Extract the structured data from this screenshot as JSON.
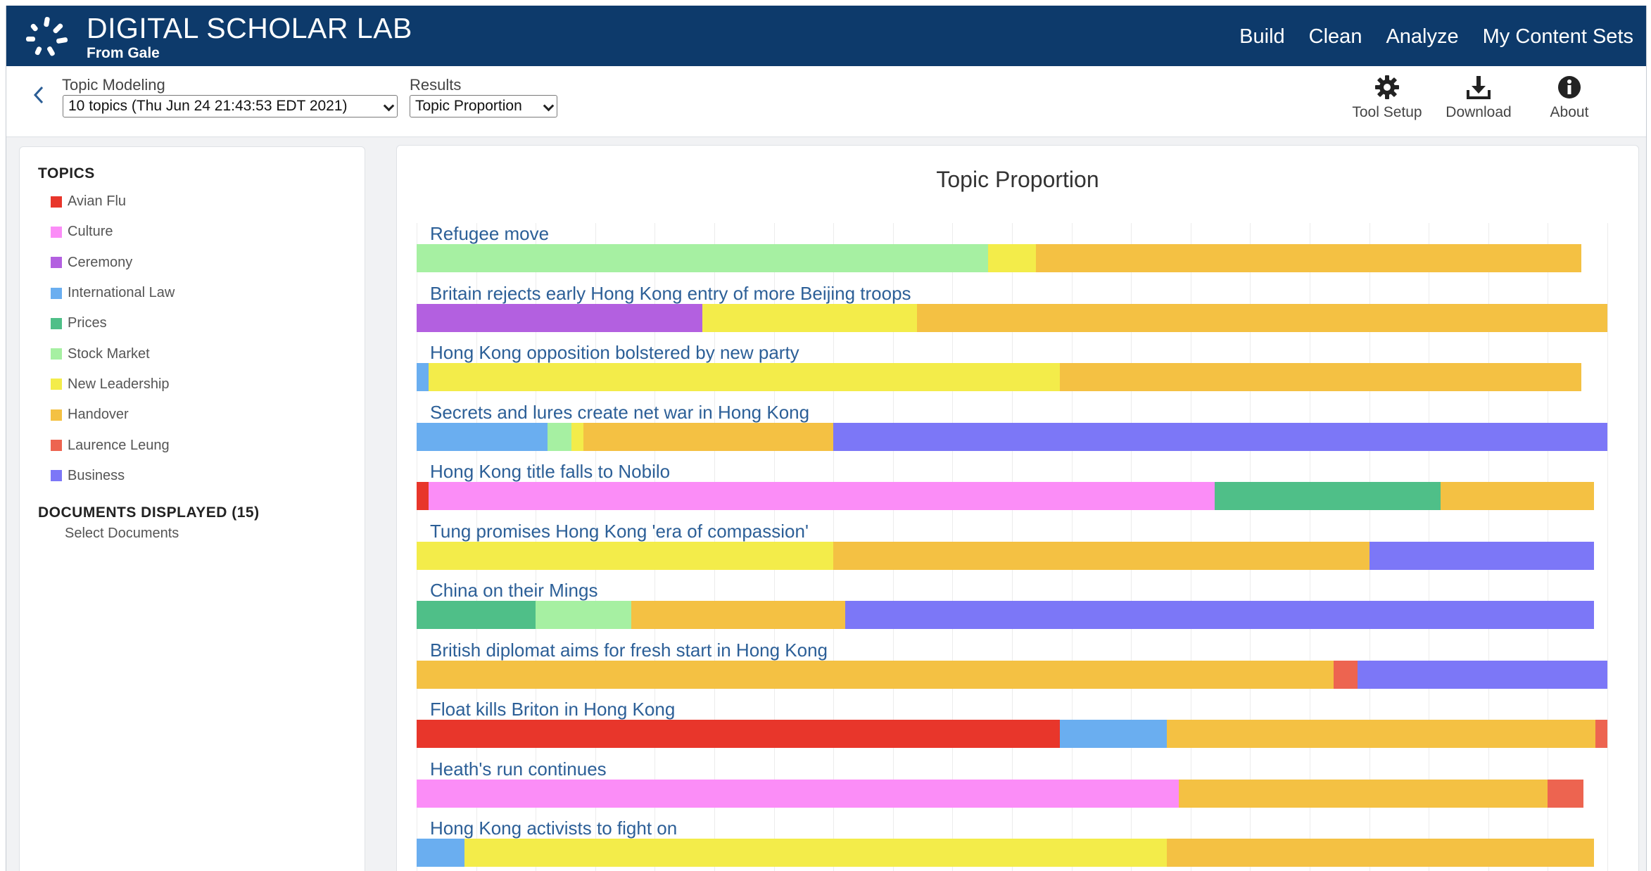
{
  "app": {
    "brand": "DIGITAL SCHOLAR LAB",
    "brand_sub": "From Gale",
    "nav": [
      "Build",
      "Clean",
      "Analyze",
      "My Content Sets"
    ],
    "header_color": "#0d3a6b"
  },
  "toolbar": {
    "back_icon": "chevron-left-icon",
    "tool_label": "Topic Modeling",
    "tool_select_value": "10 topics (Thu Jun 24 21:43:53 EDT 2021)",
    "results_label": "Results",
    "results_select_value": "Topic Proportion",
    "actions": [
      {
        "label": "Tool Setup",
        "icon": "gear-icon"
      },
      {
        "label": "Download",
        "icon": "download-icon"
      },
      {
        "label": "About",
        "icon": "info-icon"
      }
    ]
  },
  "sidebar": {
    "topics_heading": "TOPICS",
    "topics": [
      {
        "label": "Avian Flu",
        "color": "#e8362b"
      },
      {
        "label": "Culture",
        "color": "#fb8df7"
      },
      {
        "label": "Ceremony",
        "color": "#b360e0"
      },
      {
        "label": "International Law",
        "color": "#6aaef0"
      },
      {
        "label": "Prices",
        "color": "#4fbf88"
      },
      {
        "label": "Stock Market",
        "color": "#a6f0a2"
      },
      {
        "label": "New Leadership",
        "color": "#f3ec4a"
      },
      {
        "label": "Handover",
        "color": "#f4c143"
      },
      {
        "label": "Laurence Leung",
        "color": "#ed6450"
      },
      {
        "label": "Business",
        "color": "#7c77f7"
      }
    ],
    "documents_heading": "DOCUMENTS DISPLAYED (15)",
    "select_documents": "Select Documents"
  },
  "chart_data": {
    "type": "bar",
    "orientation": "horizontal",
    "stacked": true,
    "title": "Topic Proportion",
    "xlim": [
      0,
      1
    ],
    "grid": true,
    "rows": [
      {
        "label": "Refugee move",
        "segments": [
          [
            "Stock Market",
            0.48
          ],
          [
            "New Leadership",
            0.04
          ],
          [
            "Handover",
            0.458
          ]
        ]
      },
      {
        "label": "Britain rejects early Hong Kong entry of more Beijing troops",
        "segments": [
          [
            "Ceremony",
            0.24
          ],
          [
            "New Leadership",
            0.18
          ],
          [
            "Handover",
            0.58
          ]
        ]
      },
      {
        "label": "Hong Kong opposition bolstered by new party",
        "segments": [
          [
            "International Law",
            0.01
          ],
          [
            "New Leadership",
            0.53
          ],
          [
            "Handover",
            0.438
          ]
        ]
      },
      {
        "label": "Secrets and lures create net war in Hong Kong",
        "segments": [
          [
            "International Law",
            0.11
          ],
          [
            "Stock Market",
            0.02
          ],
          [
            "New Leadership",
            0.01
          ],
          [
            "Handover",
            0.21
          ],
          [
            "Business",
            0.65
          ]
        ]
      },
      {
        "label": "Hong Kong title falls to Nobilo",
        "segments": [
          [
            "Avian Flu",
            0.01
          ],
          [
            "Culture",
            0.66
          ],
          [
            "Prices",
            0.19
          ],
          [
            "Handover",
            0.129
          ]
        ]
      },
      {
        "label": "Tung promises Hong Kong 'era of compassion'",
        "segments": [
          [
            "New Leadership",
            0.35
          ],
          [
            "Handover",
            0.45
          ],
          [
            "Business",
            0.189
          ]
        ]
      },
      {
        "label": "China on their Mings",
        "segments": [
          [
            "Prices",
            0.1
          ],
          [
            "Stock Market",
            0.08
          ],
          [
            "Handover",
            0.18
          ],
          [
            "Business",
            0.629
          ]
        ]
      },
      {
        "label": "British diplomat aims for fresh start in Hong Kong",
        "segments": [
          [
            "Handover",
            0.77
          ],
          [
            "Laurence Leung",
            0.02
          ],
          [
            "Business",
            0.21
          ]
        ]
      },
      {
        "label": "Float kills Briton in Hong Kong",
        "segments": [
          [
            "Avian Flu",
            0.54
          ],
          [
            "International Law",
            0.09
          ],
          [
            "Handover",
            0.36
          ],
          [
            "Laurence Leung",
            0.01
          ]
        ]
      },
      {
        "label": "Heath's run continues",
        "segments": [
          [
            "Culture",
            0.64
          ],
          [
            "Handover",
            0.31
          ],
          [
            "Laurence Leung",
            0.03
          ]
        ]
      },
      {
        "label": "Hong Kong activists to fight on",
        "segments": [
          [
            "International Law",
            0.04
          ],
          [
            "New Leadership",
            0.59
          ],
          [
            "Handover",
            0.359
          ]
        ]
      }
    ]
  }
}
